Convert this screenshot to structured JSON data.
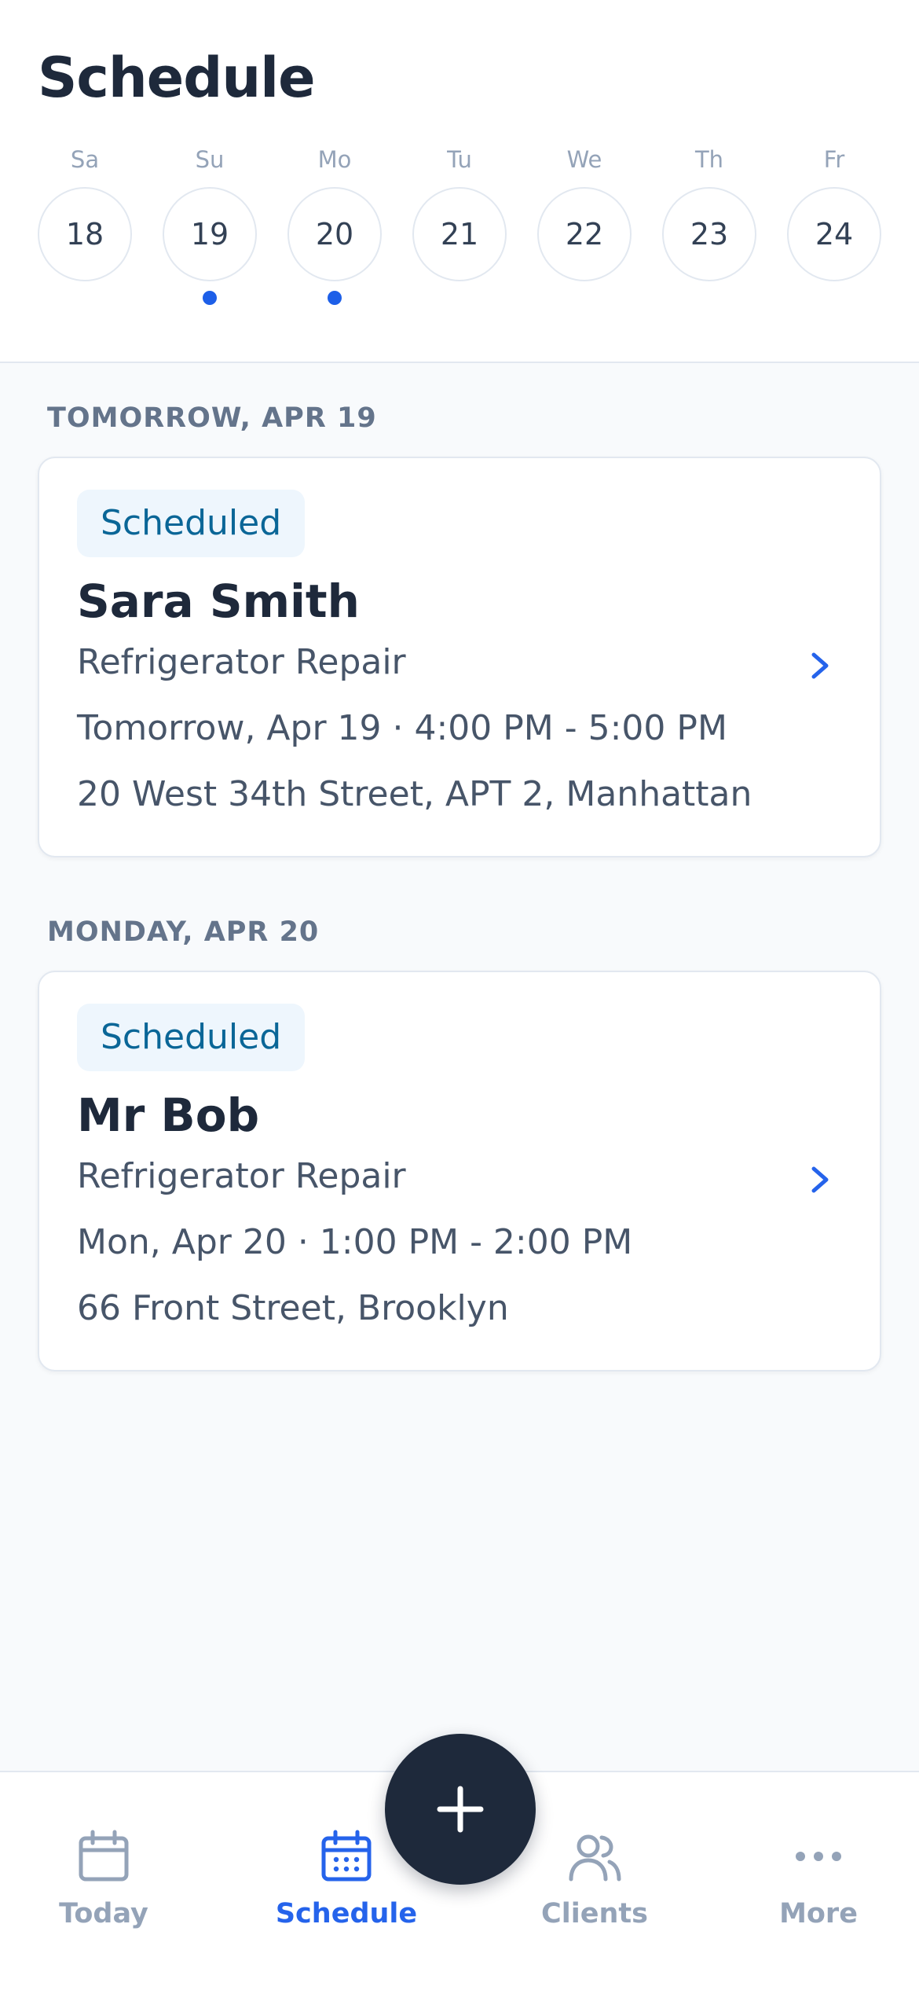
{
  "header": {
    "title": "Schedule"
  },
  "week": {
    "days": [
      {
        "label": "Sa",
        "date": "18",
        "has_appointment": false
      },
      {
        "label": "Su",
        "date": "19",
        "has_appointment": true
      },
      {
        "label": "Mo",
        "date": "20",
        "has_appointment": true
      },
      {
        "label": "Tu",
        "date": "21",
        "has_appointment": false
      },
      {
        "label": "We",
        "date": "22",
        "has_appointment": false
      },
      {
        "label": "Th",
        "date": "23",
        "has_appointment": false
      },
      {
        "label": "Fr",
        "date": "24",
        "has_appointment": false
      }
    ]
  },
  "sections": [
    {
      "label": "TOMORROW, APR 19",
      "appointment": {
        "status": "Scheduled",
        "client": "Sara Smith",
        "service": "Refrigerator Repair",
        "time": "Tomorrow, Apr 19 · 4:00 PM - 5:00 PM",
        "address": "20 West 34th Street, APT 2, Manhattan"
      }
    },
    {
      "label": "MONDAY, APR 20",
      "appointment": {
        "status": "Scheduled",
        "client": "Mr Bob",
        "service": "Refrigerator Repair",
        "time": "Mon, Apr 20 · 1:00 PM - 2:00 PM",
        "address": "66 Front Street, Brooklyn"
      }
    }
  ],
  "nav": {
    "items": [
      {
        "label": "Today",
        "icon": "calendar-icon",
        "active": false
      },
      {
        "label": "Schedule",
        "icon": "calendar-grid-icon",
        "active": true
      },
      {
        "label": "Clients",
        "icon": "users-icon",
        "active": false
      },
      {
        "label": "More",
        "icon": "more-dots-icon",
        "active": false
      }
    ],
    "fab_icon": "plus-icon"
  },
  "colors": {
    "accent": "#2563eb",
    "dot": "#1d5fe8",
    "badge_bg": "#eef6fd",
    "badge_text": "#0a6697",
    "fab": "#1e293b",
    "inactive": "#94a3b8"
  }
}
